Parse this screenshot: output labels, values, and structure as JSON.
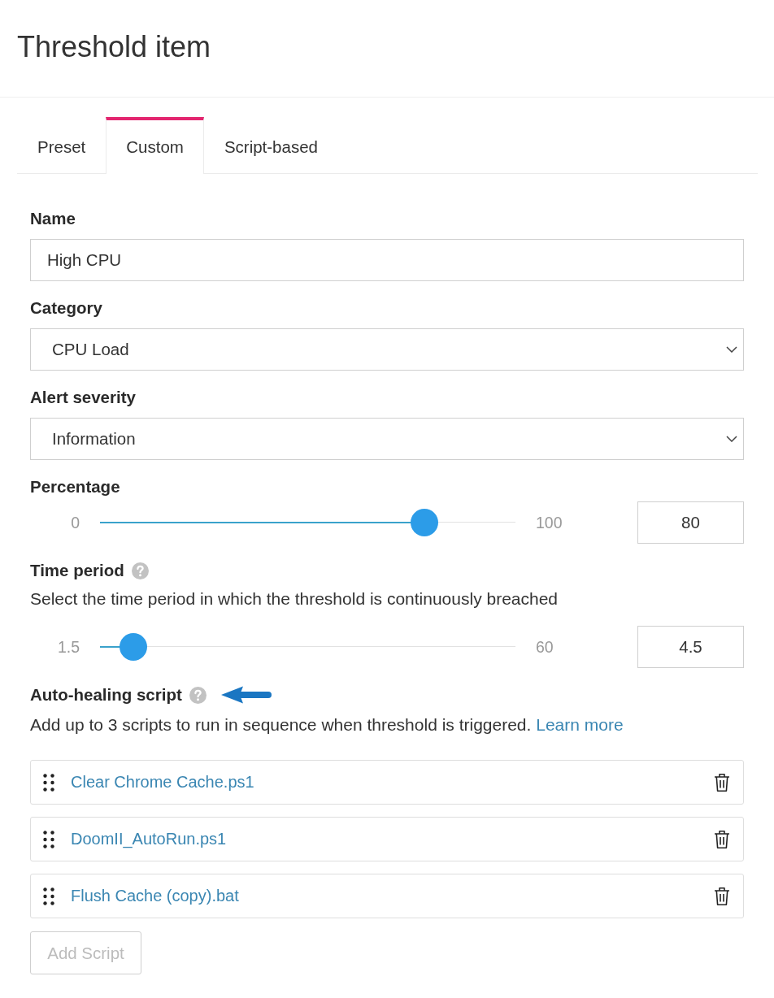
{
  "title": "Threshold item",
  "tabs": [
    {
      "label": "Preset",
      "selected": false
    },
    {
      "label": "Custom",
      "selected": true
    },
    {
      "label": "Script-based",
      "selected": false
    }
  ],
  "fields": [
    {
      "kind": "text",
      "label": "Name",
      "value": "High CPU"
    },
    {
      "kind": "select",
      "label": "Category",
      "value": "CPU Load"
    },
    {
      "kind": "select",
      "label": "Alert severity",
      "value": "Information"
    },
    {
      "kind": "slider",
      "label": "Percentage",
      "min_label": "0",
      "max_label": "100",
      "level": 0.8,
      "value": "80"
    },
    {
      "kind": "slider",
      "label": "Time period",
      "help": true,
      "description": "Select the time period in which the threshold is continuously breached",
      "min_label": "1.5",
      "max_label": "60",
      "level": 0.051,
      "value": "4.5"
    }
  ],
  "auto_healing": {
    "label": "Auto-healing script",
    "help": true,
    "annotation_arrow": true,
    "description": "Add up to 3 scripts to run in sequence when threshold is triggered.",
    "link": "Learn more",
    "scripts": [
      {
        "name": "Clear Chrome Cache.ps1"
      },
      {
        "name": "DoomII_AutoRun.ps1"
      },
      {
        "name": "Flush Cache (copy).bat"
      }
    ],
    "add_button": {
      "label": "Add Script",
      "disabled": true
    }
  }
}
